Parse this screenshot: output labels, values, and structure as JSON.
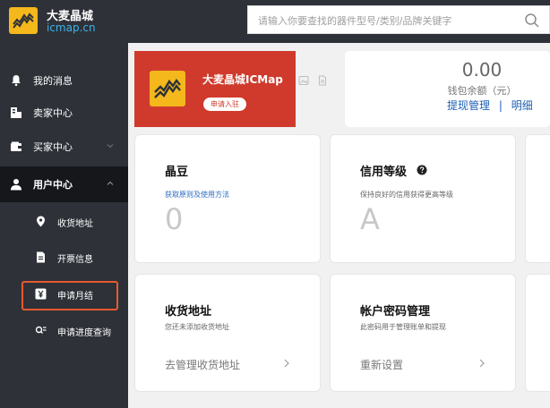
{
  "header": {
    "brand_name": "大麦晶城",
    "brand_domain": "icmap.cn",
    "search_placeholder": "请输入你要查找的器件型号/类别/品牌关键字"
  },
  "sidebar": {
    "items": [
      {
        "label": "我的消息",
        "icon": "bell-icon"
      },
      {
        "label": "卖家中心",
        "icon": "store-icon"
      },
      {
        "label": "买家中心",
        "icon": "wallet-icon"
      },
      {
        "label": "用户中心",
        "icon": "user-icon"
      }
    ],
    "sub_items": [
      {
        "label": "收货地址",
        "icon": "location-pin-icon"
      },
      {
        "label": "开票信息",
        "icon": "invoice-icon"
      },
      {
        "label": "申请月结",
        "icon": "yen-icon"
      },
      {
        "label": "申请进度查询",
        "icon": "search-list-icon"
      }
    ]
  },
  "banner": {
    "title": "大麦晶城ICMap",
    "button": "申请入驻"
  },
  "wallet": {
    "amount": "0.00",
    "label": "钱包余额（元）",
    "link_withdraw": "提现管理",
    "separator": "|",
    "link_detail": "明细"
  },
  "cards": {
    "beans": {
      "title": "晶豆",
      "link": "获取原则及使用方法",
      "value": "0"
    },
    "credit": {
      "title": "信用等级",
      "sub": "保持良好的信用获得更高等级",
      "value": "A"
    },
    "address": {
      "title": "收货地址",
      "sub": "您还未添加收货地址",
      "action": "去管理收货地址"
    },
    "password": {
      "title": "帐户密码管理",
      "sub": "此密码用于管理账单和提现",
      "action": "重新设置"
    }
  },
  "colors": {
    "sidebar_bg": "#2e3138",
    "active_bg": "#15171b",
    "banner_red": "#cf3a2c",
    "logo_yellow": "#f4b71c",
    "link_blue": "#1e5fb3",
    "highlight": "#e65a2f"
  }
}
